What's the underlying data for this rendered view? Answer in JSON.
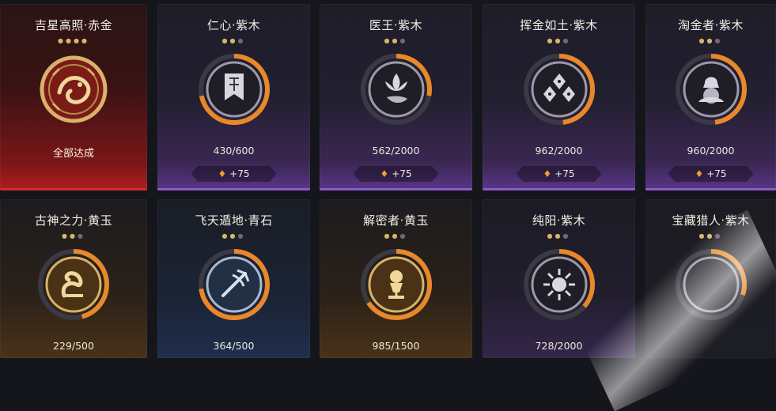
{
  "colors": {
    "progress_ring": "#e8882a",
    "ring_track": "#3a3944",
    "dot_on": "#d7b46a",
    "dot_off": "#6d6a73",
    "red_accent": "#d6282a",
    "purple_accent": "#8a5cc8"
  },
  "achievements": [
    {
      "title": "吉星高照·赤金",
      "stars": 4,
      "filled": 4,
      "status": "全部达成",
      "icon": "koi-fish-medal-icon",
      "progress": 1.0
    },
    {
      "title": "仁心·紫木",
      "stars": 3,
      "filled": 2,
      "progress_text": "430/600",
      "progress": 0.717,
      "reward": "+75",
      "icon": "banner-icon"
    },
    {
      "title": "医王·紫木",
      "stars": 3,
      "filled": 2,
      "progress_text": "562/2000",
      "progress": 0.281,
      "reward": "+75",
      "icon": "lotus-hand-icon"
    },
    {
      "title": "挥金如土·紫木",
      "stars": 3,
      "filled": 2,
      "progress_text": "962/2000",
      "progress": 0.481,
      "reward": "+75",
      "icon": "gold-ingots-icon"
    },
    {
      "title": "淘金者·紫木",
      "stars": 3,
      "filled": 2,
      "progress_text": "960/2000",
      "progress": 0.48,
      "reward": "+75",
      "icon": "treasure-sack-icon"
    },
    {
      "title": "古神之力·黄玉",
      "stars": 3,
      "filled": 2,
      "progress_text": "229/500",
      "progress": 0.458,
      "icon": "serpent-medal-icon"
    },
    {
      "title": "飞天遁地·青石",
      "stars": 3,
      "filled": 2,
      "progress_text": "364/500",
      "progress": 0.728,
      "icon": "trident-icon"
    },
    {
      "title": "解密者·黄玉",
      "stars": 3,
      "filled": 2,
      "progress_text": "985/1500",
      "progress": 0.657,
      "icon": "relic-chalice-icon"
    },
    {
      "title": "纯阳·紫木",
      "stars": 3,
      "filled": 2,
      "progress_text": "728/2000",
      "progress": 0.364,
      "icon": "sun-emblem-icon"
    },
    {
      "title": "宝藏猎人·紫木",
      "stars": 3,
      "filled": 2,
      "progress": 0.3,
      "icon": "treasure-hunter-icon"
    }
  ]
}
